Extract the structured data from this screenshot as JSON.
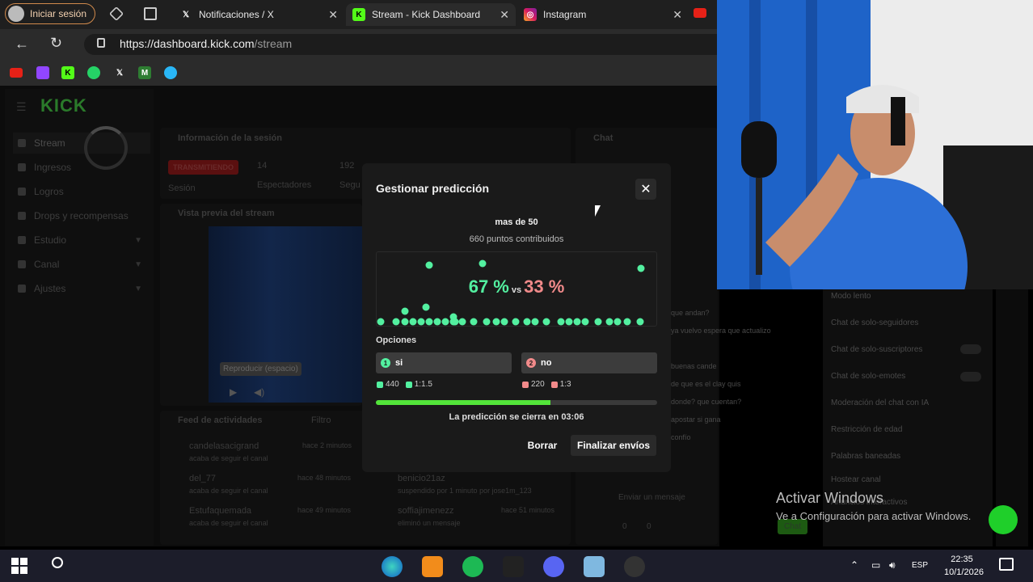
{
  "browser": {
    "signin_label": "Iniciar sesión",
    "tabs": [
      {
        "label": "Notificaciones / X",
        "icon": "x-icon"
      },
      {
        "label": "Stream - Kick Dashboard",
        "icon": "kick-icon",
        "active": true
      },
      {
        "label": "Instagram",
        "icon": "instagram-icon"
      }
    ],
    "url_host": "https://dashboard.kick.com",
    "url_path": "/stream"
  },
  "sidebar": {
    "logo": "KICK",
    "items": [
      {
        "label": "Stream",
        "active": true
      },
      {
        "label": "Ingresos"
      },
      {
        "label": "Logros"
      },
      {
        "label": "Drops y recompensas"
      },
      {
        "label": "Estudio",
        "expandable": true
      },
      {
        "label": "Canal",
        "expandable": true
      },
      {
        "label": "Ajustes",
        "expandable": true
      }
    ]
  },
  "session": {
    "header": "Información de la sesión",
    "badge": "TRANSMITIENDO",
    "badge_sub": "Sesión",
    "viewers": "14",
    "viewers_label": "Espectadores",
    "followers": "192",
    "followers_label": "Segu"
  },
  "preview": {
    "header": "Vista previa del stream",
    "overlay": "Reproducir (espacio)"
  },
  "activity": {
    "header": "Feed de actividades",
    "filter": "Filtro",
    "left_items": [
      {
        "user": "candelasacigrand",
        "time": "hace 2 minutos",
        "desc": "acaba de seguir el canal"
      },
      {
        "user": "del_77",
        "time": "hace 48 minutos",
        "desc": "acaba de seguir el canal"
      },
      {
        "user": "Estufaquemada",
        "time": "hace 49 minutos",
        "desc": "acaba de seguir el canal"
      }
    ],
    "right_items": [
      {
        "user": "benicio21az",
        "time": "",
        "desc": "suspendido por 1 minuto por jose1m_123"
      },
      {
        "user": "soffiajimenezz",
        "time": "hace 51 minutos",
        "desc": "eliminó un mensaje"
      }
    ]
  },
  "chat": {
    "header": "Chat",
    "messages": [
      "que andan?",
      "ya vuelvo espera que actualizo",
      "buenas cande",
      "de que es el clay quis",
      "donde? que cuentan?",
      "apostar si gana",
      "confío"
    ],
    "input_placeholder": "Enviar un mensaje",
    "send": "Chat",
    "stats": [
      "0",
      "0"
    ]
  },
  "chat_settings": {
    "items": [
      "Modo lento",
      "Chat de solo-seguidores",
      "Chat de solo-suscriptores",
      "Chat de solo-emotes",
      "Moderación del chat con IA",
      "Restricción de edad",
      "Palabras baneadas",
      "Hostear canal",
      "Anuncios interactivos"
    ]
  },
  "modal": {
    "title": "Gestionar predicción",
    "question": "mas de 50",
    "points": "660 puntos contribuidos",
    "percent_a": "67 %",
    "vs": "vs",
    "percent_b": "33 %",
    "options_label": "Opciones",
    "options": [
      {
        "num": "1",
        "label": "si",
        "points": "440",
        "ratio": "1:1.5",
        "color": "#53f0a0"
      },
      {
        "num": "2",
        "label": "no",
        "points": "220",
        "ratio": "1:3",
        "color": "#f18a8a"
      }
    ],
    "timer_progress": 0.62,
    "closes_text": "La predicción se cierra en 03:06",
    "btn_delete": "Borrar",
    "btn_finish": "Finalizar envíos"
  },
  "watermark": {
    "line1": "Activar Windows",
    "line2": "Ve a Configuración para activar Windows."
  },
  "taskbar": {
    "lang": "ESP",
    "time": "22:35",
    "date": "10/1/2026"
  }
}
